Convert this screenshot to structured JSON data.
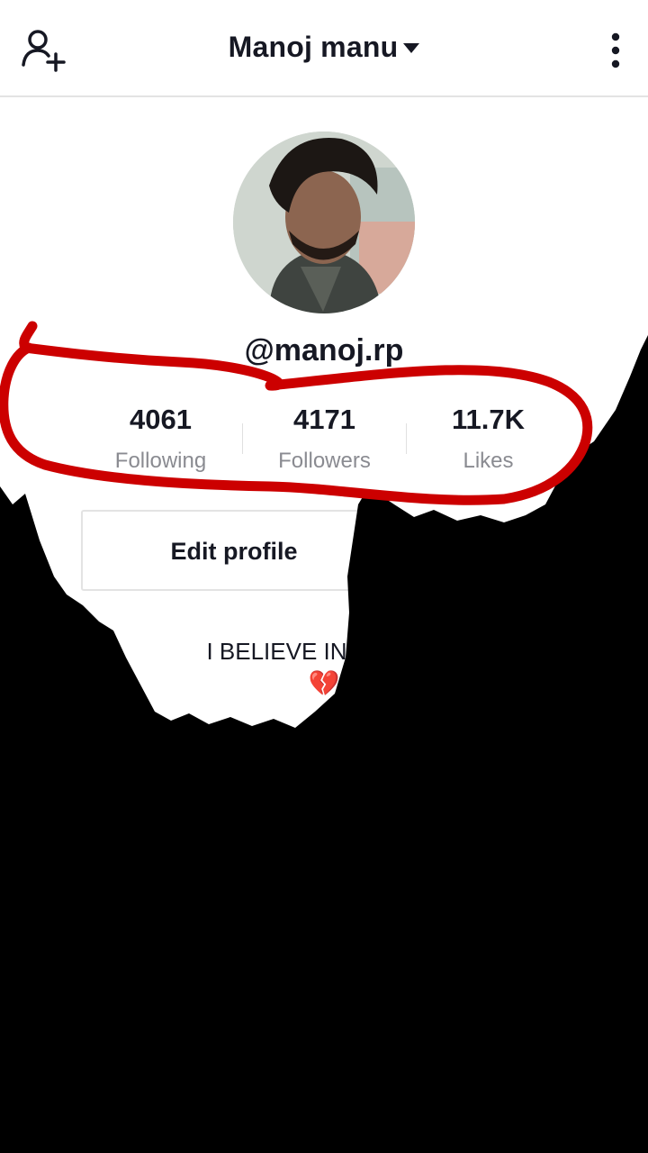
{
  "header": {
    "title": "Manoj manu",
    "add_user_icon": "add-user-icon",
    "menu_icon": "more-vertical-icon"
  },
  "profile": {
    "avatar": "profile-photo",
    "handle": "@manoj.rp",
    "stats": [
      {
        "value": "4061",
        "label": "Following"
      },
      {
        "value": "4171",
        "label": "Followers"
      },
      {
        "value": "11.7K",
        "label": "Likes"
      }
    ],
    "edit_label": "Edit profile",
    "bio": "I BELIEVE IN THE MA",
    "bio_emoji": "💔"
  },
  "colors": {
    "text": "#161823",
    "muted": "#8a8b91",
    "annotation": "#cc0000",
    "border": "#e3e3e3"
  }
}
